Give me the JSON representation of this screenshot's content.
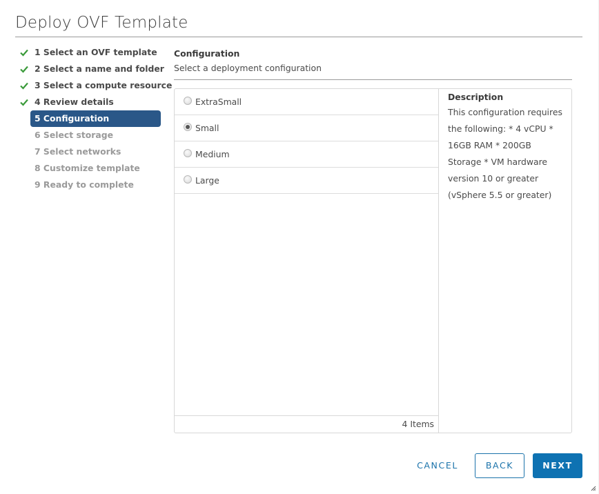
{
  "dialog": {
    "title": "Deploy OVF Template"
  },
  "steps": [
    {
      "label": "1 Select an OVF template",
      "state": "done"
    },
    {
      "label": "2 Select a name and folder",
      "state": "done"
    },
    {
      "label": "3 Select a compute resource",
      "state": "done"
    },
    {
      "label": "4 Review details",
      "state": "done"
    },
    {
      "label": "5 Configuration",
      "state": "active"
    },
    {
      "label": "6 Select storage",
      "state": "future"
    },
    {
      "label": "7 Select networks",
      "state": "future"
    },
    {
      "label": "8 Customize template",
      "state": "future"
    },
    {
      "label": "9 Ready to complete",
      "state": "future"
    }
  ],
  "content": {
    "title": "Configuration",
    "subtitle": "Select a deployment configuration",
    "options": [
      {
        "label": "ExtraSmall",
        "selected": false
      },
      {
        "label": "Small",
        "selected": true
      },
      {
        "label": "Medium",
        "selected": false
      },
      {
        "label": "Large",
        "selected": false
      }
    ],
    "item_count": "4 Items",
    "description": {
      "title": "Description",
      "body": "This configuration requires the following: * 4 vCPU * 16GB RAM * 200GB Storage * VM hardware version 10 or greater (vSphere 5.5 or greater)"
    }
  },
  "footer": {
    "cancel_label": "CANCEL",
    "back_label": "BACK",
    "next_label": "NEXT"
  },
  "icons": {
    "step_done": "check-icon",
    "resize": "resize-grip-icon"
  },
  "colors": {
    "accent": "#0e72b2",
    "active_step": "#2a5788",
    "check": "#3a9a3a"
  }
}
